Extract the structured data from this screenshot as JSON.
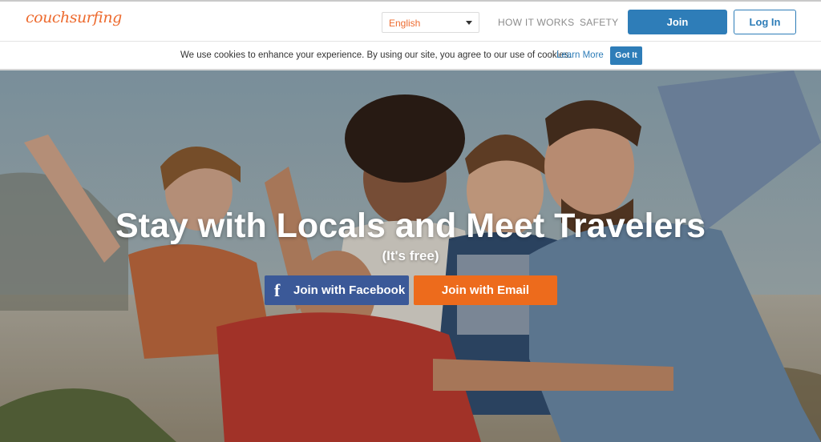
{
  "header": {
    "logo_text": "couchsurfing",
    "language": "English",
    "nav": {
      "how_it_works": "HOW IT WORKS",
      "safety": "SAFETY"
    },
    "join_label": "Join",
    "login_label": "Log In"
  },
  "cookie": {
    "message": "We use cookies to enhance your experience. By using our site, you agree to our use of cookies.",
    "learn_more": "Learn More",
    "got_it": "Got It"
  },
  "hero": {
    "title": "Stay with Locals and Meet Travelers",
    "subtitle": "(It's free)",
    "facebook_button": "Join with Facebook",
    "facebook_glyph": "f",
    "email_button": "Join with Email"
  },
  "colors": {
    "brand_orange": "#ed6b2f",
    "primary_blue": "#2e7db8",
    "facebook_blue": "#3b5998",
    "email_orange": "#ed6b1c"
  }
}
